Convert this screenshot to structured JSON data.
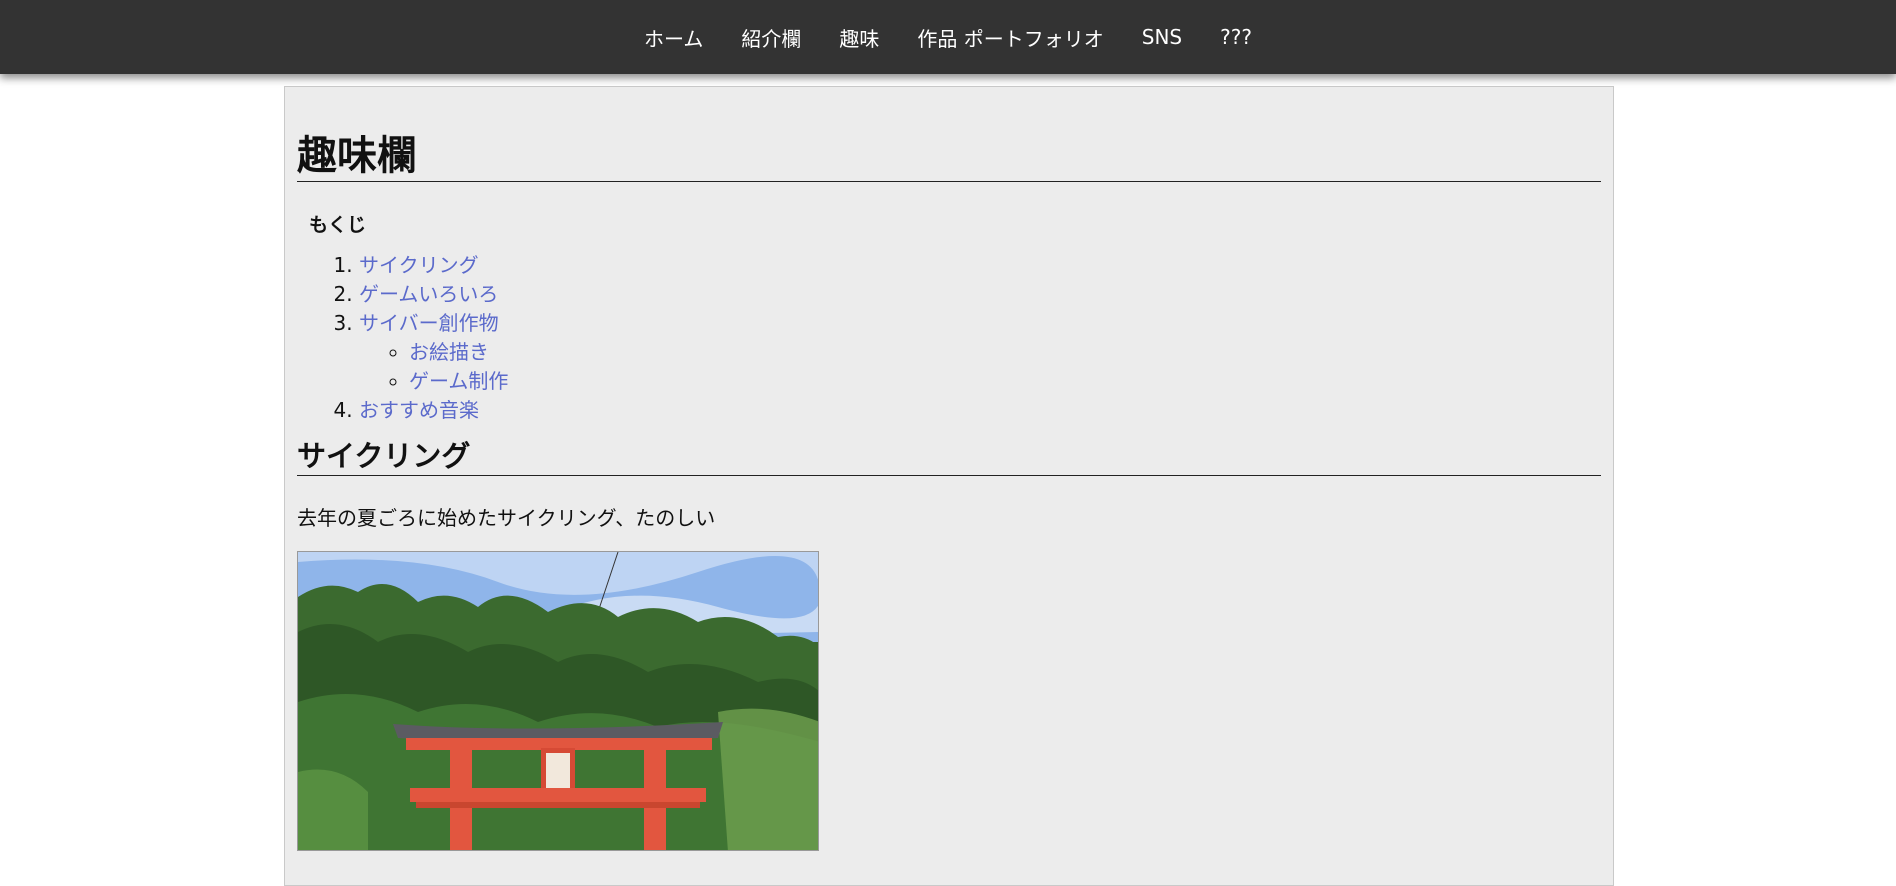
{
  "nav": {
    "items": [
      {
        "label": "ホーム"
      },
      {
        "label": "紹介欄"
      },
      {
        "label": "趣味"
      },
      {
        "label": "作品 ポートフォリオ"
      },
      {
        "label": "SNS"
      },
      {
        "label": "???"
      }
    ]
  },
  "page": {
    "title": "趣味欄"
  },
  "toc": {
    "heading": "もくじ",
    "items": [
      {
        "label": "サイクリング"
      },
      {
        "label": "ゲームいろいろ"
      },
      {
        "label": "サイバー創作物",
        "children": [
          {
            "label": "お絵描き"
          },
          {
            "label": "ゲーム制作"
          }
        ]
      },
      {
        "label": "おすすめ音楽"
      }
    ]
  },
  "cycling": {
    "title": "サイクリング",
    "text": "去年の夏ごろに始めたサイクリング、たのしい"
  },
  "colors": {
    "nav_bg": "#333333",
    "link": "#5b6acb",
    "content_bg": "#ececec",
    "torii": "#e2563f"
  }
}
